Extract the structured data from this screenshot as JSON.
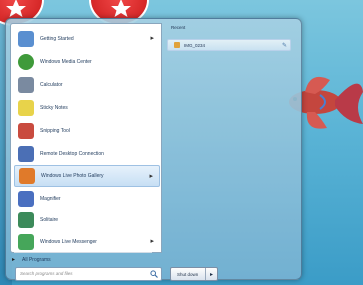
{
  "start_menu": {
    "programs": [
      {
        "label": "Getting Started",
        "icon": "getting-started-icon",
        "color": "#5a8fd0",
        "has_arrow": true
      },
      {
        "label": "Windows Media Center",
        "icon": "media-center-icon",
        "color": "#3f9a3a",
        "has_arrow": false
      },
      {
        "label": "Calculator",
        "icon": "calculator-icon",
        "color": "#7a8aa0",
        "has_arrow": false
      },
      {
        "label": "Sticky Notes",
        "icon": "sticky-notes-icon",
        "color": "#e8d34a",
        "has_arrow": false
      },
      {
        "label": "Snipping Tool",
        "icon": "scissors-icon",
        "color": "#c94b3f",
        "has_arrow": false
      },
      {
        "label": "Remote Desktop Connection",
        "icon": "remote-desktop-icon",
        "color": "#4b6fb5",
        "has_arrow": false
      },
      {
        "label": "Windows Live Photo Gallery",
        "icon": "photo-gallery-icon",
        "color": "#e07a2a",
        "has_arrow": true,
        "highlighted": true
      },
      {
        "label": "Magnifier",
        "icon": "magnifier-icon",
        "color": "#4a6fc0",
        "has_arrow": false
      },
      {
        "label": "Solitaire",
        "icon": "solitaire-icon",
        "color": "#3c8a5a",
        "has_arrow": false
      },
      {
        "label": "Windows Live Messenger",
        "icon": "messenger-icon",
        "color": "#46a65a",
        "has_arrow": true
      }
    ],
    "all_programs_label": "All Programs",
    "search_placeholder": "Search programs and files",
    "recent": {
      "title": "Recent",
      "items": [
        {
          "label": "IMG_0234"
        }
      ]
    },
    "shutdown_label": "Shut down"
  }
}
